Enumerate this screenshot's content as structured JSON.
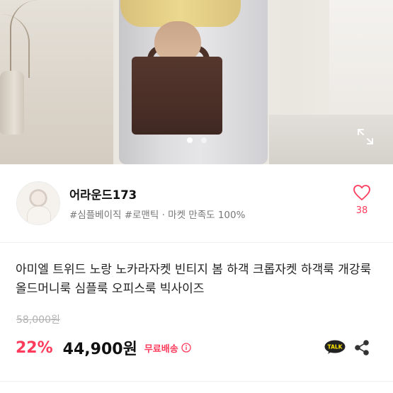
{
  "seller": {
    "name": "어라운드173",
    "meta": "#심플베이직 #로맨틱 · 마켓 만족도 100%",
    "likes": "38"
  },
  "product": {
    "title": "아미엘 트위드 노랑 노카라자켓 빈티지 봄 하객 크롭자켓 하객룩 개강룩 올드머니룩 심플룩 오피스룩 빅사이즈",
    "original_price": "58,000원",
    "discount": "22%",
    "price": "44,900원",
    "shipping": "무료배송"
  },
  "carousel": {
    "total": 2,
    "active_index": 0
  },
  "talk_label": "TALK",
  "colors": {
    "accent": "#ff3b5c",
    "talk_bg": "#222222",
    "talk_text": "#fee500"
  },
  "icons": [
    "expand-icon",
    "heart-icon",
    "info-icon",
    "talk-icon",
    "share-icon"
  ]
}
